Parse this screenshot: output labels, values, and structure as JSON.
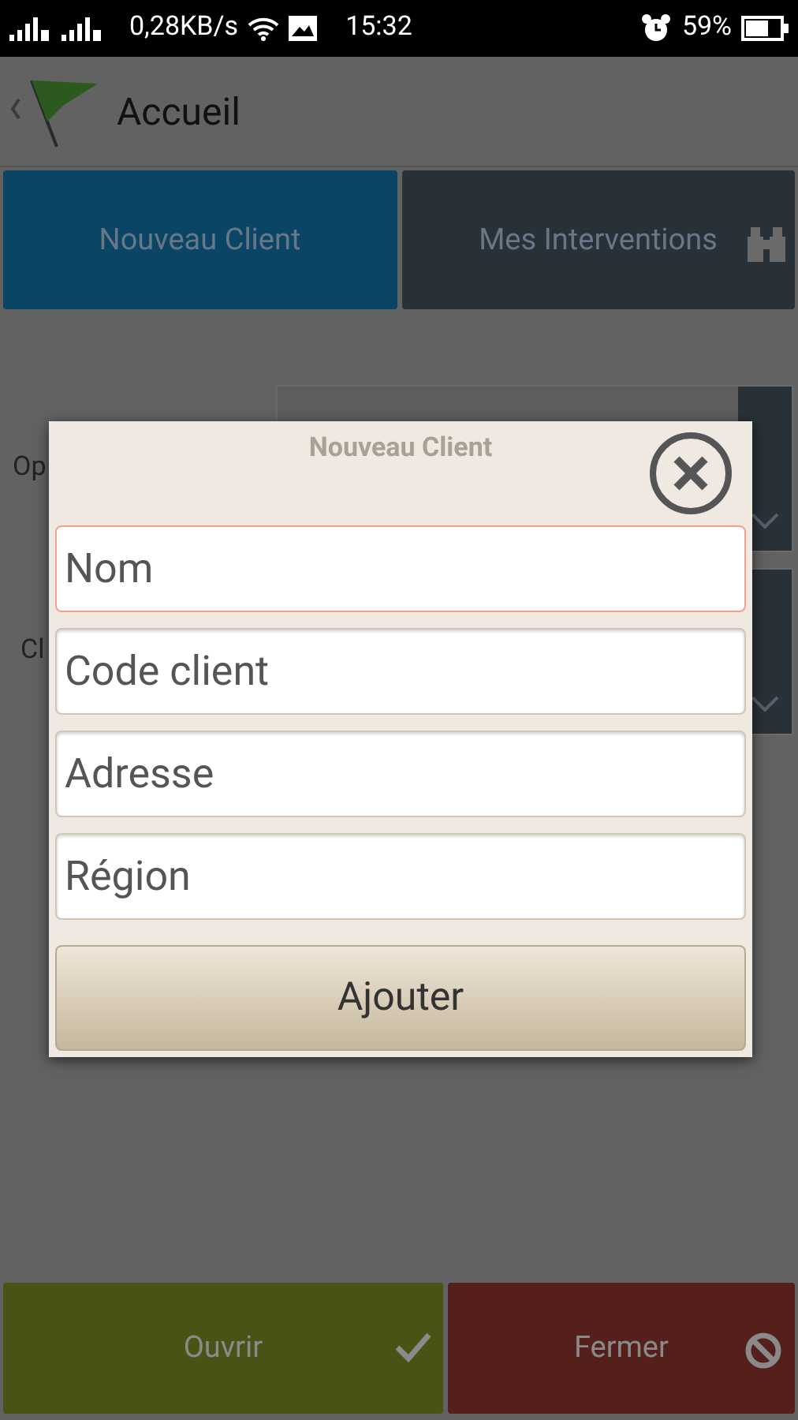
{
  "status_bar": {
    "speed": "0,28KB/s",
    "time": "15:32",
    "battery": "59%"
  },
  "header": {
    "title": "Accueil"
  },
  "tabs": [
    {
      "label": "Nouveau Client",
      "selected": true
    },
    {
      "label": "Mes Interventions",
      "selected": false
    }
  ],
  "form_rows": [
    {
      "label": "Op"
    },
    {
      "label": "Cl"
    }
  ],
  "dialog": {
    "title": "Nouveau Client",
    "fields": [
      {
        "placeholder": "Nom",
        "focused": true
      },
      {
        "placeholder": "Code client",
        "focused": false
      },
      {
        "placeholder": "Adresse",
        "focused": false
      },
      {
        "placeholder": "Région",
        "focused": false
      }
    ],
    "button": "Ajouter"
  },
  "actions": [
    {
      "label": "Ouvrir",
      "kind": "confirm"
    },
    {
      "label": "Fermer",
      "kind": "cancel"
    }
  ]
}
